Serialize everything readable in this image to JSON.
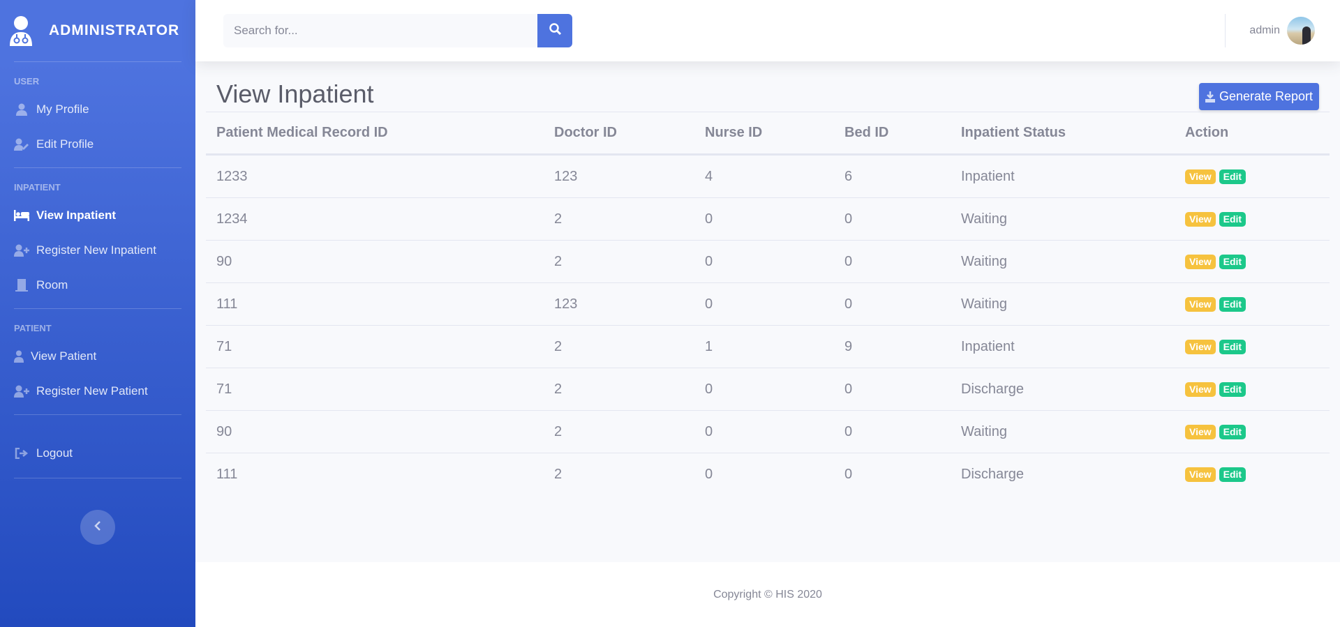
{
  "sidebar": {
    "brand": "ADMINISTRATOR",
    "sections": {
      "user": "USER",
      "inpatient": "INPATIENT",
      "patient": "PATIENT"
    },
    "items": {
      "my_profile": "My Profile",
      "edit_profile": "Edit Profile",
      "view_inpatient": "View Inpatient",
      "register_inpatient": "Register New Inpatient",
      "room": "Room",
      "view_patient": "View Patient",
      "register_patient": "Register New Patient",
      "logout": "Logout"
    }
  },
  "topbar": {
    "search_placeholder": "Search for...",
    "user_name": "admin"
  },
  "main": {
    "title": "View Inpatient",
    "report_button": "Generate Report",
    "table": {
      "headers": {
        "record": "Patient Medical Record ID",
        "doctor": "Doctor ID",
        "nurse": "Nurse ID",
        "bed": "Bed ID",
        "status": "Inpatient Status",
        "action": "Action"
      },
      "action_labels": {
        "view": "View",
        "edit": "Edit"
      },
      "rows": [
        {
          "record": "1233",
          "doctor": "123",
          "nurse": "4",
          "bed": "6",
          "status": "Inpatient"
        },
        {
          "record": "1234",
          "doctor": "2",
          "nurse": "0",
          "bed": "0",
          "status": "Waiting"
        },
        {
          "record": "90",
          "doctor": "2",
          "nurse": "0",
          "bed": "0",
          "status": "Waiting"
        },
        {
          "record": "111",
          "doctor": "123",
          "nurse": "0",
          "bed": "0",
          "status": "Waiting"
        },
        {
          "record": "71",
          "doctor": "2",
          "nurse": "1",
          "bed": "9",
          "status": "Inpatient"
        },
        {
          "record": "71",
          "doctor": "2",
          "nurse": "0",
          "bed": "0",
          "status": "Discharge"
        },
        {
          "record": "90",
          "doctor": "2",
          "nurse": "0",
          "bed": "0",
          "status": "Waiting"
        },
        {
          "record": "111",
          "doctor": "2",
          "nurse": "0",
          "bed": "0",
          "status": "Discharge"
        }
      ]
    }
  },
  "footer": {
    "copyright": "Copyright © HIS 2020"
  },
  "colors": {
    "primary": "#4e73df",
    "sidebar_end": "#224abe",
    "view_badge": "#f6c23e",
    "edit_badge": "#1cc88a"
  },
  "icons": {
    "brand": "user-doctor-icon",
    "my_profile": "user-icon",
    "edit_profile": "user-edit-icon",
    "view_inpatient": "bed-icon",
    "register_inpatient": "user-plus-icon",
    "room": "door-icon",
    "view_patient": "user-injured-icon",
    "register_patient": "user-plus-icon",
    "logout": "sign-out-icon",
    "search": "search-icon",
    "report": "download-icon",
    "toggle": "chevron-left-icon"
  }
}
